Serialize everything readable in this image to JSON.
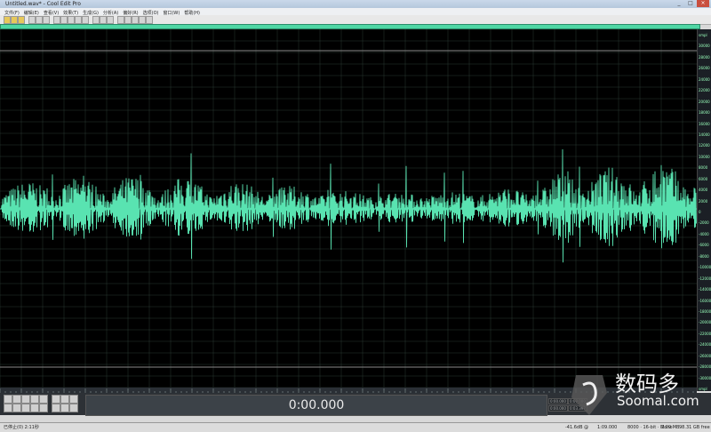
{
  "window": {
    "title": "Untitled.wav* - Cool Edit Pro",
    "min": "_",
    "max": "□",
    "close": "×"
  },
  "menu": [
    "文件(F)",
    "编辑(E)",
    "查看(V)",
    "效果(T)",
    "生成(G)",
    "分析(A)",
    "偏好(R)",
    "选项(O)",
    "窗口(W)",
    "帮助(H)"
  ],
  "toolbar_buttons": [
    {
      "icon": "multitrack-icon",
      "yellow": true
    },
    {
      "icon": "wave-icon",
      "yellow": true
    },
    {
      "icon": "cd-icon",
      "yellow": true
    },
    {
      "icon": "new-icon",
      "yellow": false
    },
    {
      "icon": "open-icon",
      "yellow": false
    },
    {
      "icon": "save-icon",
      "yellow": false
    },
    {
      "icon": "cut-icon",
      "yellow": false
    },
    {
      "icon": "copy-icon",
      "yellow": false
    },
    {
      "icon": "paste-icon",
      "yellow": false
    },
    {
      "icon": "undo-icon",
      "yellow": false
    },
    {
      "icon": "redo-icon",
      "yellow": false
    },
    {
      "icon": "zoom-icon",
      "yellow": false
    },
    {
      "icon": "spectral-icon",
      "yellow": false
    },
    {
      "icon": "settings-icon",
      "yellow": false
    },
    {
      "icon": "mixer-icon",
      "yellow": false
    },
    {
      "icon": "effects-icon",
      "yellow": false
    },
    {
      "icon": "batch-icon",
      "yellow": false
    },
    {
      "icon": "loop-icon",
      "yellow": false
    },
    {
      "icon": "help-icon",
      "yellow": false
    }
  ],
  "scale_labels": [
    "smpl",
    "30000",
    "28000",
    "26000",
    "24000",
    "22000",
    "20000",
    "18000",
    "16000",
    "14000",
    "12000",
    "10000",
    "8000",
    "6000",
    "4000",
    "2000",
    "0",
    "-2000",
    "-4000",
    "-6000",
    "-8000",
    "-10000",
    "-12000",
    "-14000",
    "-16000",
    "-18000",
    "-20000",
    "-22000",
    "-24000",
    "-26000",
    "-28000",
    "-30000",
    "smpl"
  ],
  "transport": {
    "buttons": [
      "stop-icon",
      "play-icon",
      "pause-icon",
      "play-to-end-icon",
      "loop-icon",
      "record-icon",
      "go-start-icon",
      "rewind-icon",
      "fast-forward-icon",
      "go-end-icon"
    ],
    "zoom_buttons": [
      "zoom-in-h-icon",
      "zoom-out-h-icon",
      "zoom-full-icon",
      "zoom-in-v-icon",
      "zoom-out-v-icon",
      "zoom-sel-icon"
    ],
    "time": "0:00.000",
    "small_boxes": [
      "0:00.000",
      "0:00.000",
      "0:00.000",
      "0:03.397"
    ]
  },
  "status": {
    "left": "已停止(0) 2:11秒",
    "db": "-41.6dB @",
    "pos": "1:09.000",
    "format": "8000 · 16-bit · Mono",
    "size": "2.09 MB",
    "free": "98.31 GB free"
  },
  "brand": {
    "cn": "数码多",
    "en": "Soomal.com"
  },
  "colors": {
    "wave": "#59e3b1",
    "bg": "#000000"
  }
}
